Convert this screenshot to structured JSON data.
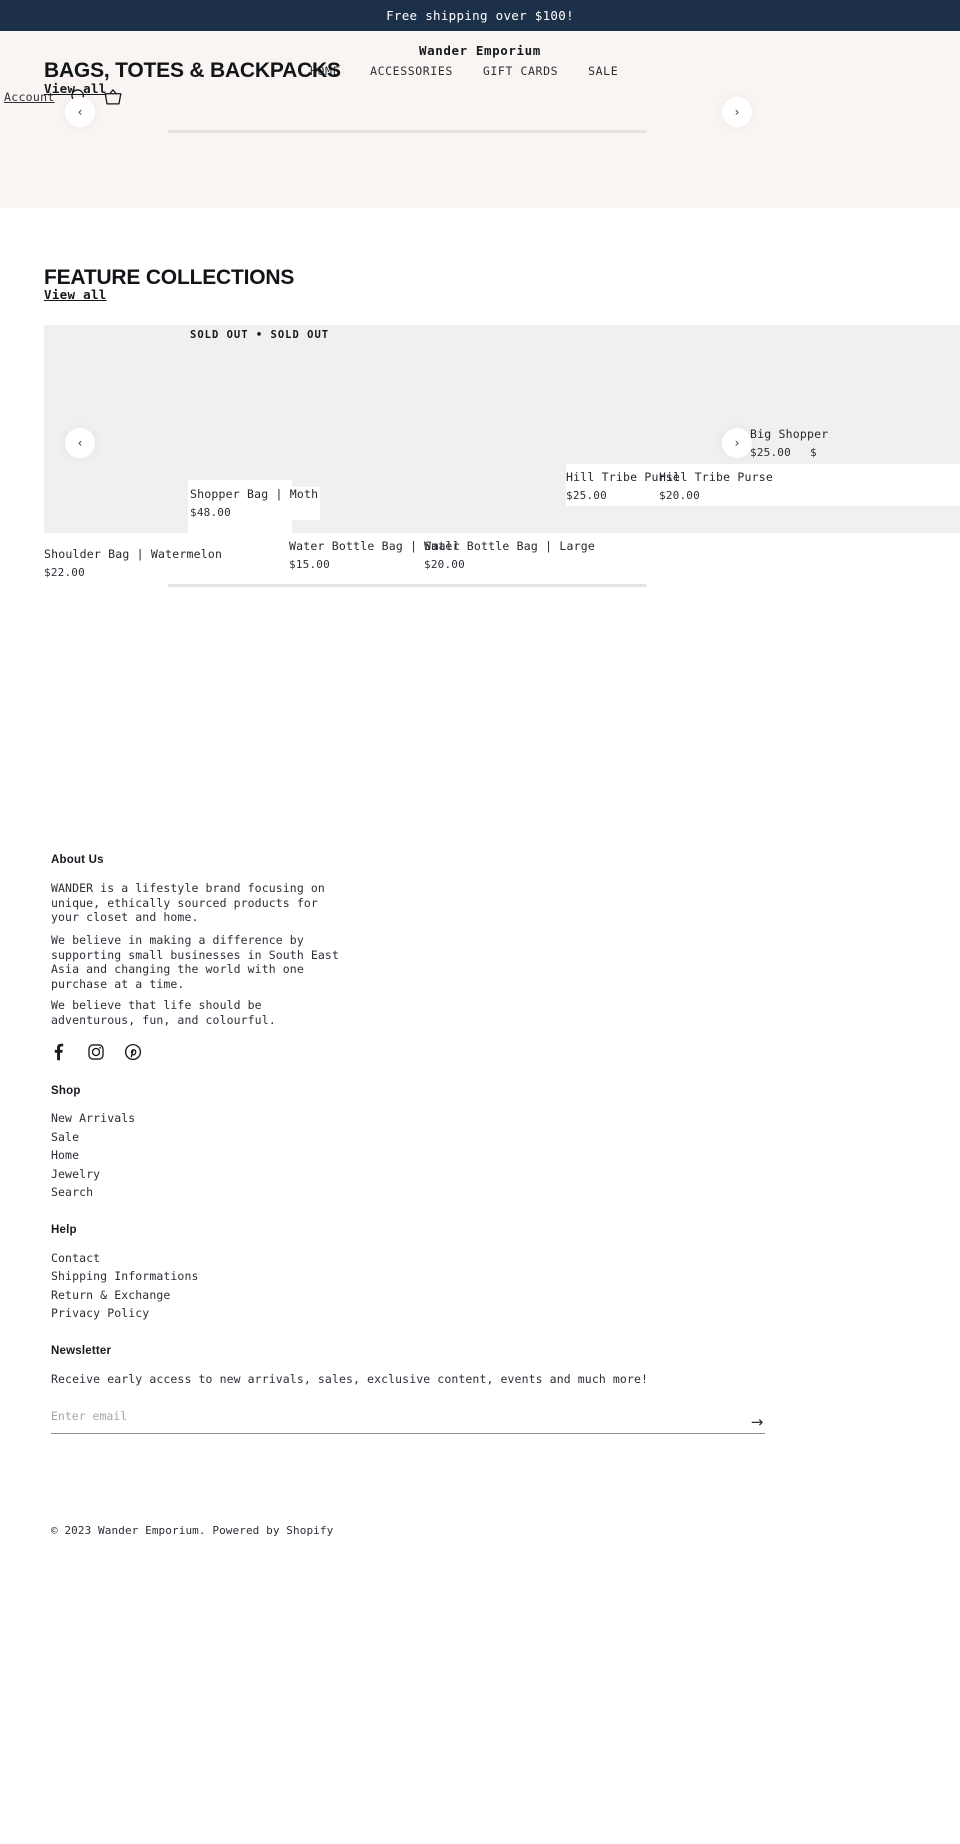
{
  "announcement": {
    "text": "Free shipping over $100!"
  },
  "header": {
    "shop_name": "Wander Emporium",
    "account_label": "Account",
    "search_icon": "search-icon",
    "cart_icon": "cart-icon",
    "nav": [
      {
        "label": "HOME"
      },
      {
        "label": "ACCESSORIES"
      },
      {
        "label": "GIFT CARDS"
      },
      {
        "label": "SALE"
      }
    ]
  },
  "hero": {
    "title": "BAGS, TOTES & BACKPACKS",
    "view_all": "View all",
    "prev_icon": "chevron-left-icon",
    "next_icon": "chevron-right-icon",
    "prev_glyph": "‹",
    "next_glyph": "›"
  },
  "feature_collections": {
    "title": "FEATURE COLLECTIONS",
    "view_all": "View all",
    "badge": "SOLD OUT  •  SOLD OUT",
    "prev_glyph": "‹",
    "next_glyph": "›",
    "products": [
      {
        "name": "Shoulder Bag | Watermelon",
        "price": "$22.00"
      },
      {
        "name": "Shopper Bag | Moth",
        "price": "$48.00"
      },
      {
        "name": "Water Bottle Bag | Small",
        "price": "$15.00"
      },
      {
        "name": "Water Bottle Bag | Large",
        "price": "$20.00"
      },
      {
        "name": "Hill Tribe Purse",
        "price": "$25.00"
      },
      {
        "name": "Hill Tribe Purse",
        "price": "$20.00"
      },
      {
        "name": "Big Shopper",
        "price": "$25.00"
      },
      {
        "name": "",
        "price": "$"
      }
    ]
  },
  "footer": {
    "about": {
      "heading": "About Us",
      "p1": "WANDER is a lifestyle brand focusing on unique, ethically sourced products for your closet and home.",
      "p2": "We believe in making a difference by supporting small businesses in South East Asia and changing the world with one purchase at a time.",
      "p3": "We believe that life should be adventurous, fun, and colourful."
    },
    "socials": [
      {
        "name": "facebook-icon"
      },
      {
        "name": "instagram-icon"
      },
      {
        "name": "pinterest-icon"
      }
    ],
    "shop": {
      "heading": "Shop",
      "links": [
        "New Arrivals",
        "Sale",
        "Home",
        "Jewelry",
        "Search"
      ]
    },
    "help": {
      "heading": "Help",
      "links": [
        "Contact",
        "Shipping Informations",
        "Return & Exchange",
        "Privacy Policy"
      ]
    },
    "newsletter": {
      "heading": "Newsletter",
      "description": "Receive early access to new arrivals, sales, exclusive content, events and much more!",
      "placeholder": "Enter email",
      "value": "",
      "submit_glyph": "→"
    },
    "copyright": "© 2023 Wander Emporium. Powered by Shopify"
  },
  "colors": {
    "announcement_bg": "#1d3049",
    "header_bg": "#faf5f2",
    "slab_bg": "#f0f0ef",
    "text": "#1b1b1b"
  }
}
